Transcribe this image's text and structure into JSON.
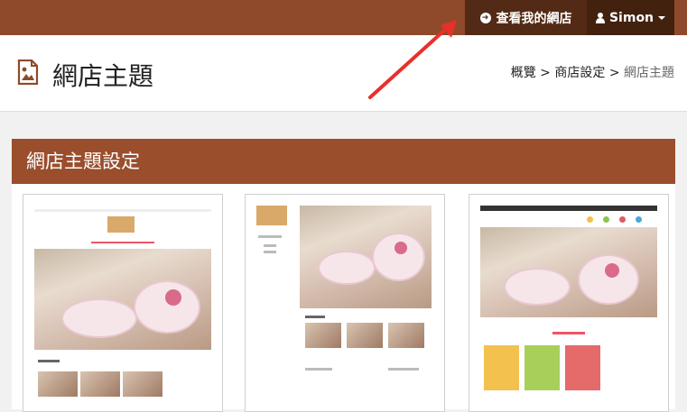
{
  "topbar": {
    "view_shop_label": "查看我的網店",
    "user_name": "Simon"
  },
  "header": {
    "title": "網店主題",
    "breadcrumb": {
      "item1": "概覽",
      "sep": ">",
      "item2": "商店設定",
      "item3": "網店主題"
    }
  },
  "panel": {
    "title": "網店主題設定"
  },
  "themes": [
    {
      "name": "theme-1"
    },
    {
      "name": "theme-2"
    },
    {
      "name": "theme-3"
    }
  ],
  "colors": {
    "topbar": "#8e4a2a",
    "view_shop_bg": "#532a15",
    "user_bg": "#42220f",
    "panel_head": "#9a4e2c",
    "annotation_arrow": "#e8302a"
  }
}
